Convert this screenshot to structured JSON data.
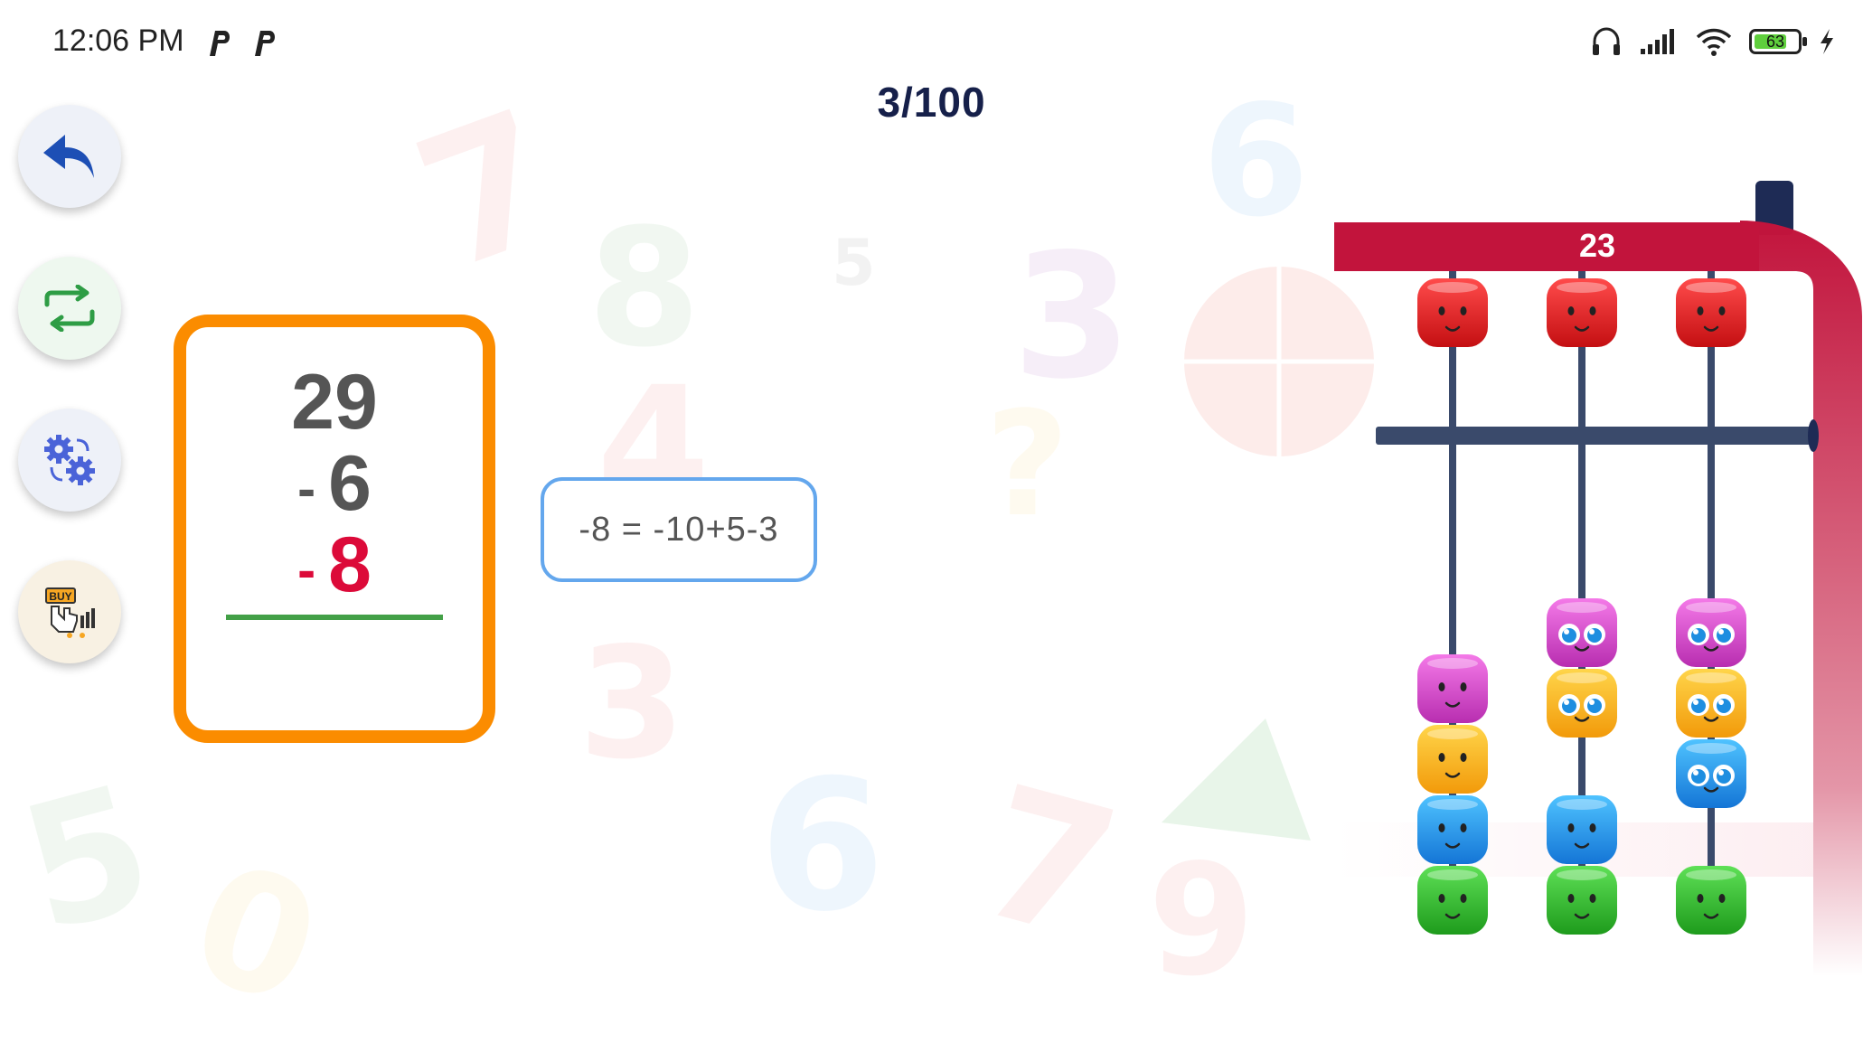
{
  "status_bar": {
    "time": "12:06 PM",
    "notification_icons": [
      "parking-icon",
      "parking-icon"
    ],
    "battery_level": "63",
    "icons": [
      "headphones-icon",
      "signal-icon",
      "wifi-icon",
      "battery-icon",
      "charging-icon"
    ]
  },
  "progress": {
    "counter": "3/100"
  },
  "side_buttons": [
    {
      "name": "back-button",
      "icon": "undo-arrow-icon"
    },
    {
      "name": "switch-button",
      "icon": "swap-arrows-icon"
    },
    {
      "name": "settings-button",
      "icon": "gears-icon"
    },
    {
      "name": "buy-button",
      "icon": "buy-hand-icon"
    }
  ],
  "problem": {
    "first_number": "29",
    "second_sign": "-",
    "second_number": "6",
    "third_sign": "-",
    "third_number": "8"
  },
  "hint": {
    "text": "-8 = -10+5-3"
  },
  "abacus": {
    "display_value": "23",
    "frame_color": "#c2143c",
    "rod_color": "#3a4a6b",
    "rods": [
      {
        "upper_bead": "red",
        "lower_beads": [
          "pink",
          "yellow",
          "blue",
          "green"
        ]
      },
      {
        "upper_bead": "red",
        "lower_beads": [
          "pink",
          "yellow",
          "blue",
          "green"
        ]
      },
      {
        "upper_bead": "red",
        "lower_beads": [
          "pink",
          "yellow",
          "blue",
          "green"
        ]
      }
    ]
  },
  "colors": {
    "accent_orange": "#fb8c00",
    "minus_red": "#dc0a39",
    "hint_border": "#64a7ed",
    "answer_line": "#43a047",
    "counter_text": "#16204a"
  }
}
